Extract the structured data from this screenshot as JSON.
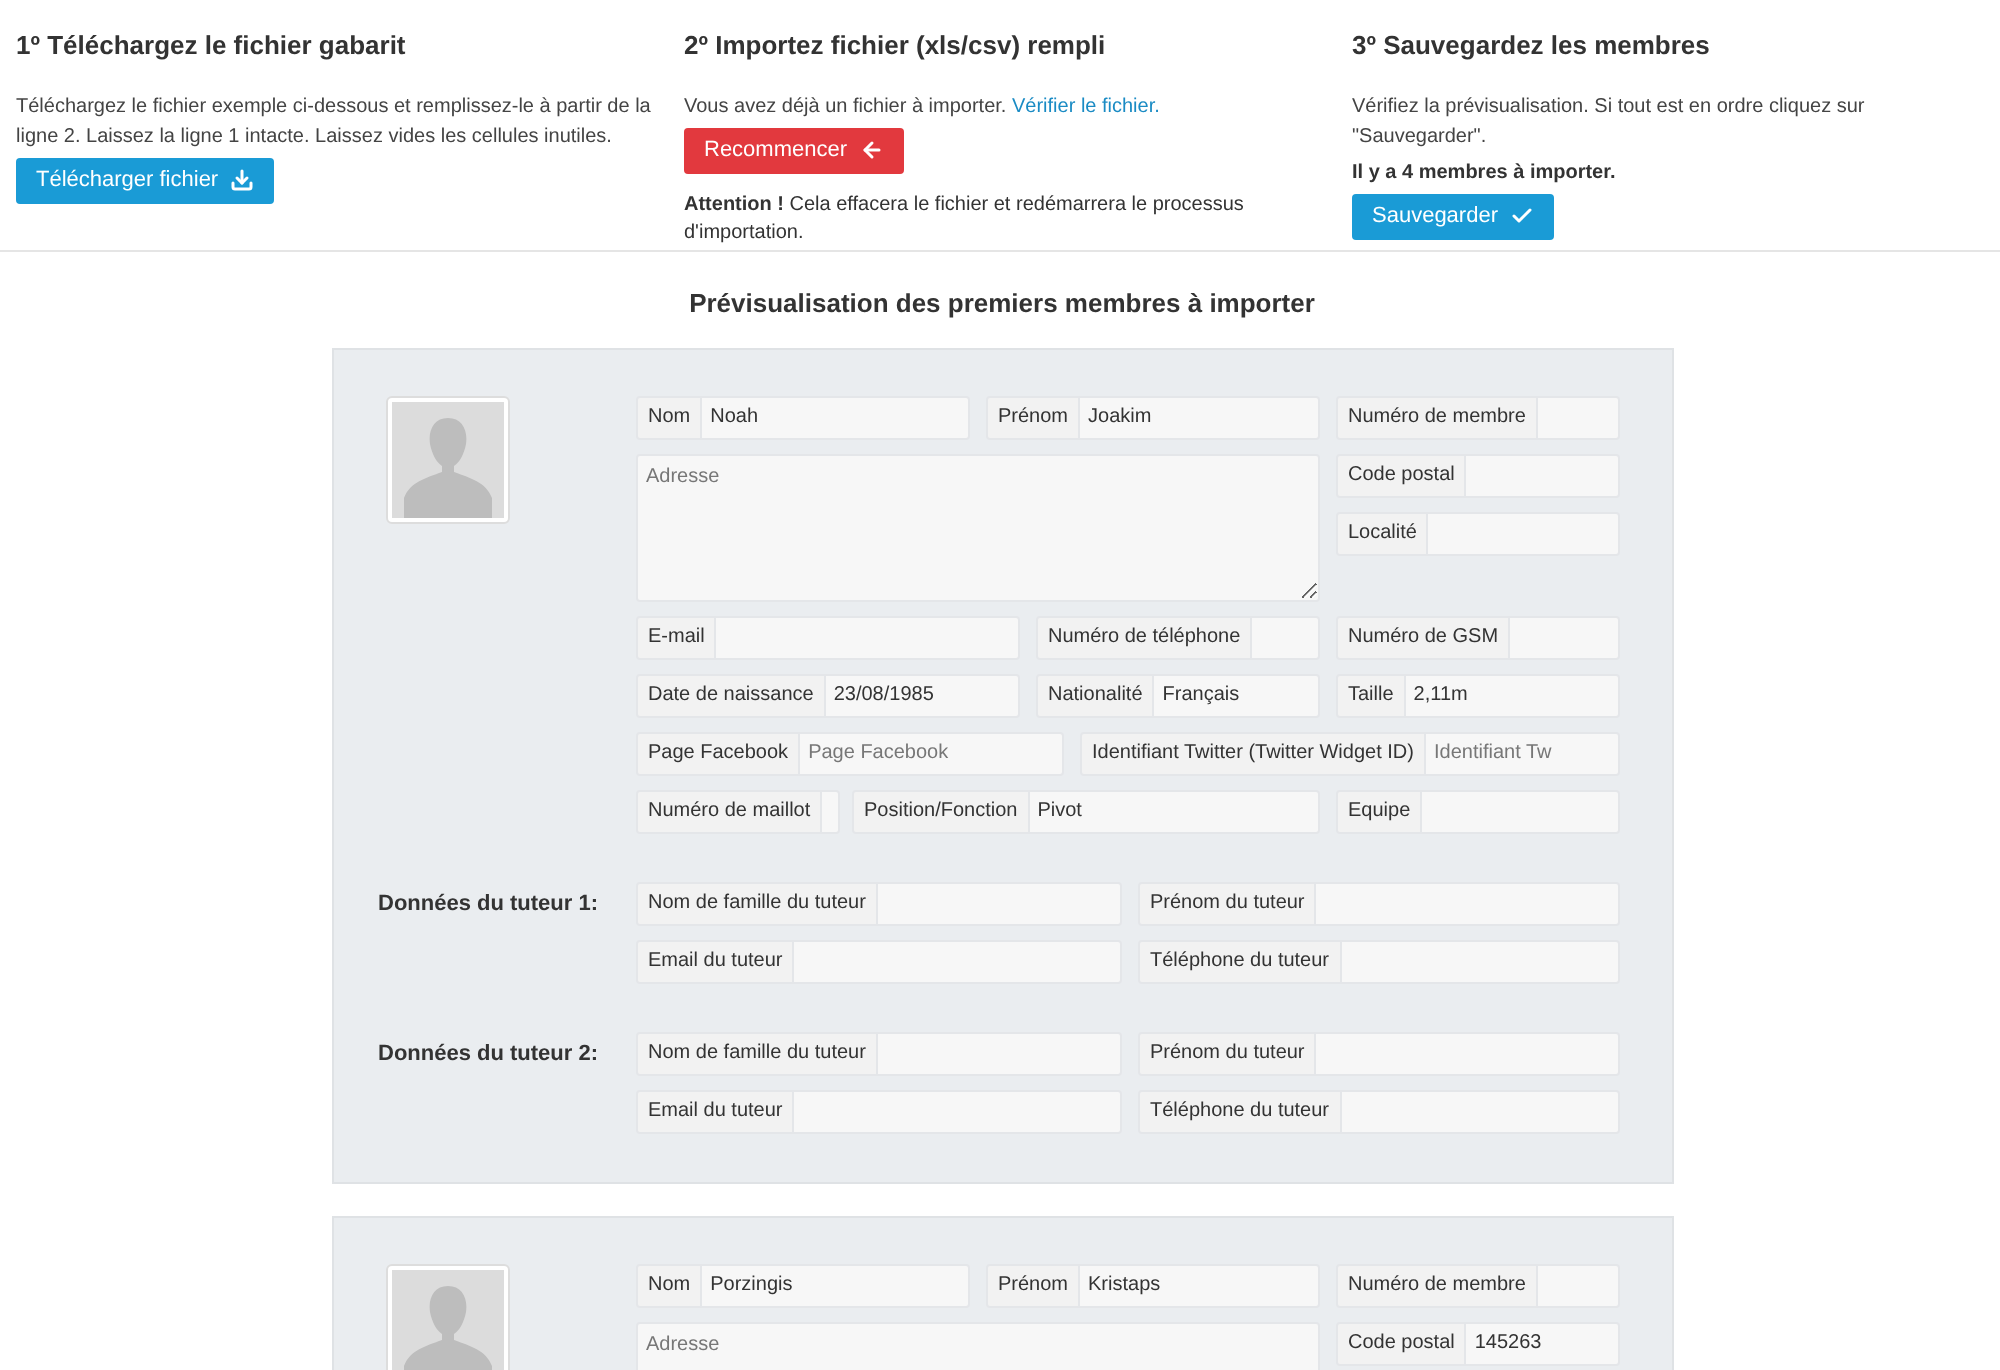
{
  "steps": [
    {
      "title": "1º Téléchargez le fichier gabarit",
      "text": "Téléchargez le fichier exemple ci-dessous et remplissez-le à partir de la ligne 2. Laissez la ligne 1 intacte. Laissez vides les cellules inutiles.",
      "button": {
        "label": "Télécharger fichier",
        "kind": "download"
      }
    },
    {
      "title": "2º Importez fichier (xls/csv) rempli",
      "text": "Vous avez déjà un fichier à importer.",
      "link": "Vérifier le fichier.",
      "button": {
        "label": "Recommencer",
        "kind": "restart"
      },
      "note": "**Attention !** Cela effacera le fichier et redémarrera le processus d'importation."
    },
    {
      "title": "3º Sauvegardez les membres",
      "text": "Vérifiez la prévisualisation. Si tout est en ordre cliquez sur \"Sauvegarder\".",
      "count": "Il y a 4 membres à importer.",
      "button": {
        "label": "Sauvegarder",
        "kind": "save"
      }
    }
  ],
  "preview_title": "Prévisualisation des premiers membres à importer",
  "members": [
    {
      "top": [
        {
          "label": "Nom",
          "value": "Noah"
        },
        {
          "label": "Prénom",
          "value": "Joakim"
        },
        {
          "label": "Numéro de membre"
        }
      ],
      "address": {
        "placeholder": "Adresse"
      },
      "side": [
        {
          "label": "Code postal"
        },
        {
          "label": "Localité"
        }
      ],
      "rows": [
        [
          {
            "label": "E-mail"
          },
          {
            "label": "Numéro de téléphone"
          },
          {
            "label": "Numéro de GSM"
          }
        ],
        [
          {
            "label": "Date de naissance",
            "value": "23/08/1985"
          },
          {
            "label": "Nationalité",
            "value": "Français"
          },
          {
            "label": "Taille",
            "value": "2,11m"
          }
        ],
        [
          {
            "label": "Page Facebook",
            "placeholder": "Page Facebook"
          },
          {
            "label": "Identifiant Twitter (Twitter Widget ID)",
            "placeholder": "Identifiant Tw"
          }
        ],
        [
          {
            "label": "Numéro de maillot"
          },
          {
            "label": "Position/Fonction",
            "value": "Pivot"
          },
          {
            "label": "Equipe"
          }
        ]
      ],
      "tutors": [
        {
          "title": "Données du tuteur 1:",
          "fields": [
            {
              "label": "Nom de famille du tuteur"
            },
            {
              "label": "Prénom du tuteur"
            },
            {
              "label": "Email du tuteur"
            },
            {
              "label": "Téléphone du tuteur"
            }
          ]
        },
        {
          "title": "Données du tuteur 2:",
          "fields": [
            {
              "label": "Nom de famille du tuteur"
            },
            {
              "label": "Prénom du tuteur"
            },
            {
              "label": "Email du tuteur"
            },
            {
              "label": "Téléphone du tuteur"
            }
          ]
        }
      ]
    },
    {
      "top": [
        {
          "label": "Nom",
          "value": "Porzingis"
        },
        {
          "label": "Prénom",
          "value": "Kristaps"
        },
        {
          "label": "Numéro de membre"
        }
      ],
      "address": {
        "placeholder": "Adresse"
      },
      "side": [
        {
          "label": "Code postal",
          "value": "145263"
        }
      ]
    }
  ]
}
